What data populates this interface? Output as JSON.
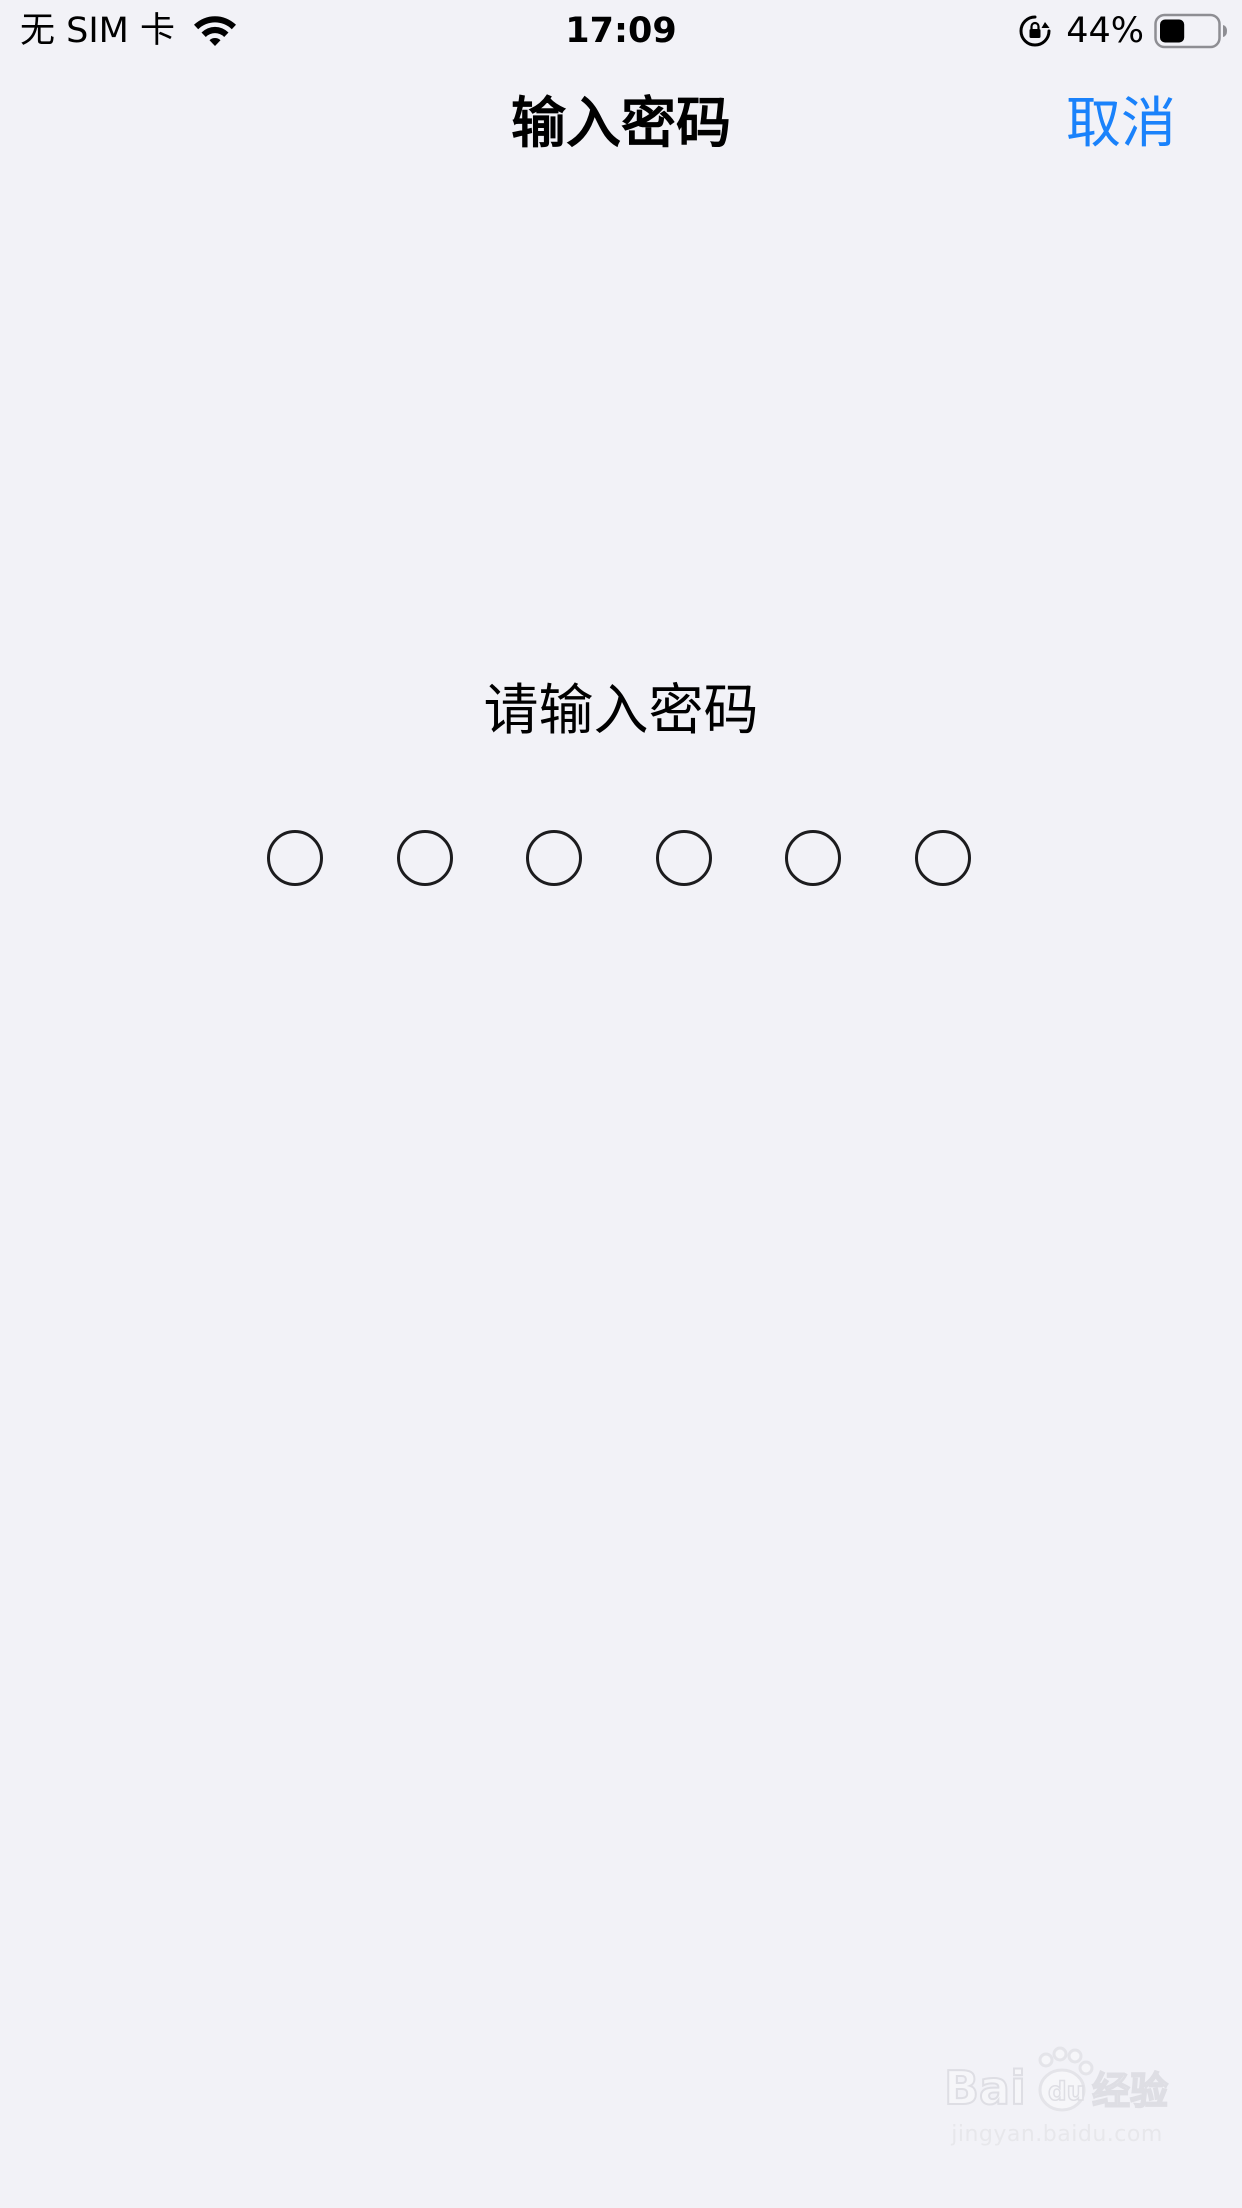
{
  "status_bar": {
    "carrier": "无 SIM 卡",
    "time": "17:09",
    "battery_percent": "44%",
    "battery_level": 0.44,
    "icons": [
      "wifi-icon",
      "rotation-lock-icon",
      "battery-icon"
    ]
  },
  "nav": {
    "title": "输入密码",
    "cancel_label": "取消"
  },
  "prompt": "请输入密码",
  "passcode": {
    "length": 6,
    "entered": 0
  },
  "watermark": {
    "logo_text": "Bai du 经验",
    "url": "jingyan.baidu.com"
  },
  "colors": {
    "background": "#f2f2f7",
    "accent": "#1a82fb",
    "text": "#000000",
    "dot_stroke": "#1c1c1e"
  }
}
